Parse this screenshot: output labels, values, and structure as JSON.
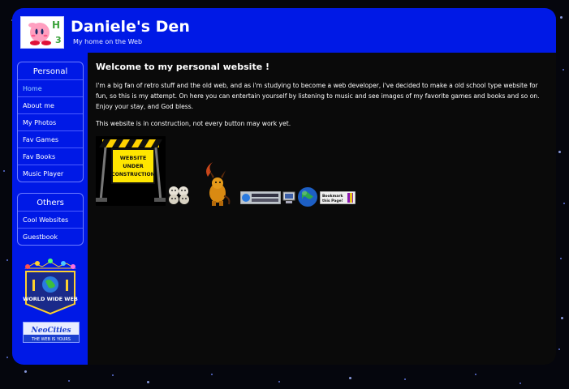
{
  "header": {
    "title": "Daniele's Den",
    "subtitle": "My home on the Web",
    "logo_alt": "Kirby icon"
  },
  "sidebar": {
    "personal": {
      "title": "Personal",
      "items": [
        {
          "label": "Home"
        },
        {
          "label": "About me"
        },
        {
          "label": "My Photos"
        },
        {
          "label": "Fav Games"
        },
        {
          "label": "Fav Books"
        },
        {
          "label": "Music Player"
        }
      ]
    },
    "others": {
      "title": "Others",
      "items": [
        {
          "label": "Cool Websites"
        },
        {
          "label": "Guestbook"
        }
      ]
    },
    "badges": {
      "www": {
        "text": "WORLD WIDE WEB"
      },
      "neocities": {
        "text": "NeoCities",
        "tagline": "THE WEB IS YOURS"
      }
    }
  },
  "main": {
    "heading": "Welcome to my personal website !",
    "paragraphs": [
      "I'm a big fan of retro stuff and the old web, and as i'm studying to become a web developer, i've decided to make a old school type website for fun, so this is my attempt. On here you can entertain yourself by listening to music and see images of my favorite games and books and so on. Enjoy your stay, and God bless.",
      "This website is in construction, not every button may work yet."
    ]
  },
  "gifs": {
    "construction": {
      "text": "WEBSITE UNDER CONSTRUCTION"
    },
    "bookmark": {
      "text": "Bookmark this Page!"
    }
  }
}
